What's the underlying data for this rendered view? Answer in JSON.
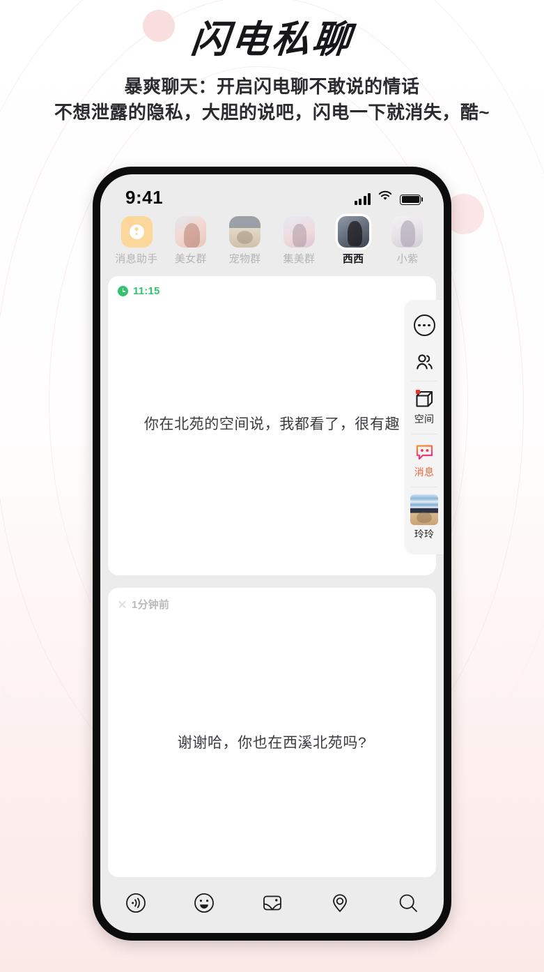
{
  "page": {
    "title": "闪电私聊",
    "subtitle_line1": "暴爽聊天：开启闪电聊不敢说的情话",
    "subtitle_line2": "不想泄露的隐私，大胆的说吧，闪电一下就消失，酷~",
    "accent_pink": "#f8dede",
    "accent_orange": "#f4643c"
  },
  "statusbar": {
    "time": "9:41",
    "signal_icon": "cellular-signal-icon",
    "wifi_icon": "wifi-icon",
    "battery_icon": "battery-full-icon"
  },
  "nav": {
    "items": [
      {
        "label": "消息助手",
        "avatar": "assistant-avatar",
        "selected": false
      },
      {
        "label": "美女群",
        "avatar": "beauty-group-avatar",
        "selected": false
      },
      {
        "label": "宠物群",
        "avatar": "pet-group-avatar",
        "selected": false
      },
      {
        "label": "集美群",
        "avatar": "sisters-group-avatar",
        "selected": false
      },
      {
        "label": "西西",
        "avatar": "xixi-avatar",
        "selected": true
      },
      {
        "label": "小紫",
        "avatar": "xiaozi-avatar",
        "selected": false
      }
    ]
  },
  "chat": {
    "cards": [
      {
        "meta_icon": "clock-icon",
        "meta_time": "11:15",
        "message": "你在北苑的空间说，我都看了，很有趣"
      },
      {
        "meta_icon": "close-icon",
        "meta_time": "1分钟前",
        "message": "谢谢哈，你也在西溪北苑吗?"
      }
    ]
  },
  "rail": {
    "items": [
      {
        "icon": "more-circle-icon",
        "label": ""
      },
      {
        "icon": "people-icon",
        "label": ""
      },
      {
        "icon": "cube-icon",
        "label": "空间",
        "badge": true
      },
      {
        "icon": "chat-bubble-icon",
        "label": "消息",
        "active": true
      },
      {
        "icon": "cat-avatar",
        "label": "玲玲"
      }
    ]
  },
  "toolbar": {
    "items": [
      {
        "icon": "voice-broadcast-icon"
      },
      {
        "icon": "emoji-smiley-icon"
      },
      {
        "icon": "image-picture-icon"
      },
      {
        "icon": "location-pin-icon"
      },
      {
        "icon": "search-icon"
      }
    ]
  }
}
